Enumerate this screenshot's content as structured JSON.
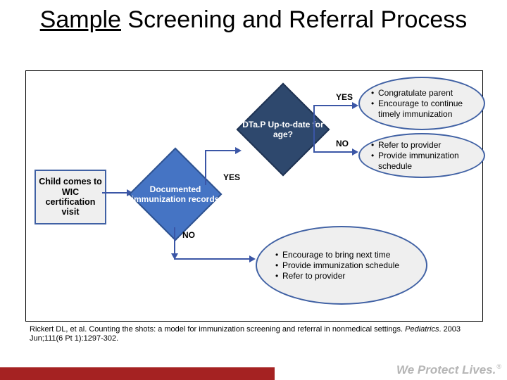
{
  "title": {
    "underlined": "Sample",
    "rest": " Screening and Referral Process"
  },
  "nodes": {
    "start": "Child comes to WIC certification visit",
    "decision1": "Documented immunization records",
    "decision2": "DTa.P Up-to-date for age?",
    "outcome_yes_yes": [
      "Congratulate parent",
      "Encourage to continue timely immunization"
    ],
    "outcome_yes_no": [
      "Refer to provider",
      "Provide immunization schedule"
    ],
    "outcome_no": [
      "Encourage to bring next time",
      "Provide immunization schedule",
      "Refer to provider"
    ]
  },
  "labels": {
    "yes1": "YES",
    "no1": "NO",
    "yes2": "YES",
    "no2": "NO"
  },
  "citation": {
    "text": "Rickert DL, et al. Counting the shots: a model for immunization screening and referral in nonmedical settings. ",
    "journal": "Pediatrics",
    "tail": ". 2003 Jun;111(6 Pt 1):1297-302."
  },
  "tagline": "We Protect Lives.",
  "regmark": "®"
}
